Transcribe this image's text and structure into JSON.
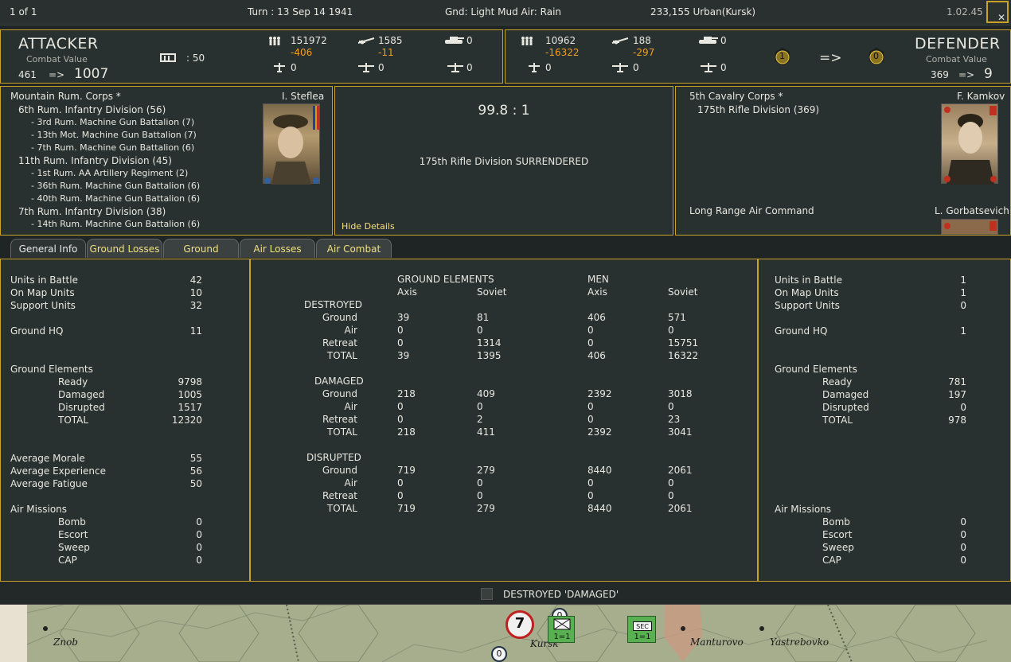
{
  "topbar": {
    "page": "1 of 1",
    "turn": "Turn : 13   Sep 14 1941",
    "weather": "Gnd: Light Mud  Air: Rain",
    "location": "233,155   Urban(Kursk)",
    "version": "1.02.45",
    "close_label": "✕"
  },
  "attacker": {
    "title": "ATTACKER",
    "cv_label": "Combat Value",
    "cv_from": "461",
    "arrow": "=>",
    "cv_to": "1007",
    "rail_value": ": 50",
    "men": "151972",
    "men_loss": "-406",
    "guns": "1585",
    "guns_loss": "-11",
    "tanks": "0",
    "fighters": "0",
    "bombers": "0",
    "transports": "0",
    "hq_name": "Mountain Rum. Corps *",
    "commander": "I. Steflea",
    "units": [
      {
        "text": "6th Rum. Infantry Division (56)",
        "level": 1
      },
      {
        "text": "- 3rd Rum. Machine Gun Battalion (7)",
        "level": 2
      },
      {
        "text": "- 13th Mot. Machine Gun Battalion (7)",
        "level": 2
      },
      {
        "text": "- 7th Rum. Machine Gun Battalion (6)",
        "level": 2
      },
      {
        "text": "11th Rum. Infantry Division (45)",
        "level": 1
      },
      {
        "text": "- 1st Rum. AA Artillery Regiment (2)",
        "level": 2
      },
      {
        "text": "- 36th Rum. Machine Gun Battalion (6)",
        "level": 2
      },
      {
        "text": "- 40th Rum. Machine Gun Battalion (6)",
        "level": 2
      },
      {
        "text": "7th Rum. Infantry Division (38)",
        "level": 1
      },
      {
        "text": "- 14th Rum. Machine Gun Battalion (6)",
        "level": 2
      }
    ]
  },
  "defender": {
    "title": "DEFENDER",
    "cv_label": "Combat Value",
    "cv_from": "369",
    "arrow": "=>",
    "cv_to": "9",
    "men": "10962",
    "men_loss": "-16322",
    "guns": "188",
    "guns_loss": "-297",
    "tanks": "0",
    "fighters": "0",
    "bombers": "0",
    "transports": "0",
    "fort_from": "1",
    "fort_arrow": "=>",
    "fort_to": "0",
    "hq_name": "5th Cavalry Corps *",
    "commander": "F. Kamkov",
    "unit": "175th Rifle Division (369)",
    "air_hq": "Long Range Air Command",
    "air_commander": "L. Gorbatsevich"
  },
  "result": {
    "odds": "99.8 : 1",
    "message": "175th Rifle Division SURRENDERED",
    "hide_details": "Hide Details"
  },
  "tabs": [
    "General Info",
    "Ground Losses",
    "Ground Combat",
    "Air Losses",
    "Air Combat"
  ],
  "left_stats": {
    "rows": [
      {
        "label": "Units in Battle",
        "value": "42",
        "indent": false
      },
      {
        "label": "On Map Units",
        "value": "10",
        "indent": false
      },
      {
        "label": "Support Units",
        "value": "32",
        "indent": false
      },
      {
        "label": "Ground HQ",
        "value": "11",
        "indent": false
      },
      {
        "label": "Ground Elements",
        "value": "",
        "indent": false
      },
      {
        "label": "Ready",
        "value": "9798",
        "indent": true
      },
      {
        "label": "Damaged",
        "value": "1005",
        "indent": true
      },
      {
        "label": "Disrupted",
        "value": "1517",
        "indent": true
      },
      {
        "label": "TOTAL",
        "value": "12320",
        "indent": true
      },
      {
        "label": "Average Morale",
        "value": "55",
        "indent": false
      },
      {
        "label": "Average Experience",
        "value": "56",
        "indent": false
      },
      {
        "label": "Average Fatigue",
        "value": "50",
        "indent": false
      },
      {
        "label": "Air Missions",
        "value": "",
        "indent": false
      },
      {
        "label": "Bomb",
        "value": "0",
        "indent": true
      },
      {
        "label": "Escort",
        "value": "0",
        "indent": true
      },
      {
        "label": "Sweep",
        "value": "0",
        "indent": true
      },
      {
        "label": "CAP",
        "value": "0",
        "indent": true
      }
    ]
  },
  "right_stats": {
    "rows": [
      {
        "label": "Units in Battle",
        "value": "1",
        "indent": false
      },
      {
        "label": "On Map Units",
        "value": "1",
        "indent": false
      },
      {
        "label": "Support Units",
        "value": "0",
        "indent": false
      },
      {
        "label": "Ground HQ",
        "value": "1",
        "indent": false
      },
      {
        "label": "Ground Elements",
        "value": "",
        "indent": false
      },
      {
        "label": "Ready",
        "value": "781",
        "indent": true
      },
      {
        "label": "Damaged",
        "value": "197",
        "indent": true
      },
      {
        "label": "Disrupted",
        "value": "0",
        "indent": true
      },
      {
        "label": "TOTAL",
        "value": "978",
        "indent": true
      },
      {
        "label": "Air Missions",
        "value": "",
        "indent": false
      },
      {
        "label": "Bomb",
        "value": "0",
        "indent": true
      },
      {
        "label": "Escort",
        "value": "0",
        "indent": true
      },
      {
        "label": "Sweep",
        "value": "0",
        "indent": true
      },
      {
        "label": "CAP",
        "value": "0",
        "indent": true
      }
    ]
  },
  "losses_table": {
    "header_ge": "GROUND ELEMENTS",
    "header_men": "MEN",
    "subheaders": [
      "Axis",
      "Soviet",
      "Axis",
      "Soviet"
    ],
    "sections": [
      {
        "title": "DESTROYED",
        "rows": [
          {
            "label": "Ground",
            "values": [
              "39",
              "81",
              "406",
              "571"
            ]
          },
          {
            "label": "Air",
            "values": [
              "0",
              "0",
              "0",
              "0"
            ]
          },
          {
            "label": "Retreat",
            "values": [
              "0",
              "1314",
              "0",
              "15751"
            ]
          },
          {
            "label": "TOTAL",
            "values": [
              "39",
              "1395",
              "406",
              "16322"
            ]
          }
        ]
      },
      {
        "title": "DAMAGED",
        "rows": [
          {
            "label": "Ground",
            "values": [
              "218",
              "409",
              "2392",
              "3018"
            ]
          },
          {
            "label": "Air",
            "values": [
              "0",
              "0",
              "0",
              "0"
            ]
          },
          {
            "label": "Retreat",
            "values": [
              "0",
              "2",
              "0",
              "23"
            ]
          },
          {
            "label": "TOTAL",
            "values": [
              "218",
              "411",
              "2392",
              "3041"
            ]
          }
        ]
      },
      {
        "title": "DISRUPTED",
        "rows": [
          {
            "label": "Ground",
            "values": [
              "719",
              "279",
              "8440",
              "2061"
            ]
          },
          {
            "label": "Air",
            "values": [
              "0",
              "0",
              "0",
              "0"
            ]
          },
          {
            "label": "Retreat",
            "values": [
              "0",
              "0",
              "0",
              "0"
            ]
          },
          {
            "label": "TOTAL",
            "values": [
              "719",
              "279",
              "8440",
              "2061"
            ]
          }
        ]
      }
    ]
  },
  "footer": {
    "checkbox_label": "DESTROYED 'DAMAGED'"
  },
  "map": {
    "places": [
      "Znob",
      "Kursk",
      "Manturovo",
      "Yastrebovko"
    ],
    "counter_sec": "SEC",
    "counter_strength": "1=1",
    "counter_zero": "0",
    "counter_seven": "7"
  },
  "colors": {
    "accent": "#c9a227",
    "loss": "#f0a020",
    "panel": "#283030",
    "tab_text": "#f0e080"
  }
}
